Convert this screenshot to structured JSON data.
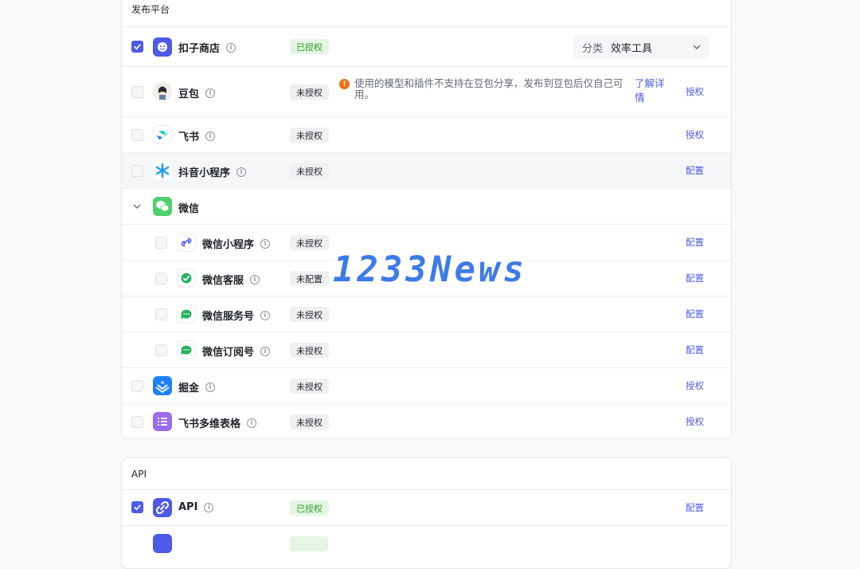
{
  "publish_section": {
    "title": "发布平台",
    "category": {
      "label": "分类",
      "value": "效率工具"
    },
    "warning": {
      "text": "使用的模型和插件不支持在豆包分享，发布到豆包后仅自己可用。",
      "link": "了解详情"
    },
    "rows": [
      {
        "name": "扣子商店",
        "status": "已授权",
        "action": "",
        "checked": true
      },
      {
        "name": "豆包",
        "status": "未授权",
        "action": "授权",
        "checked": false
      },
      {
        "name": "飞书",
        "status": "未授权",
        "action": "授权",
        "checked": false
      },
      {
        "name": "抖音小程序",
        "status": "未授权",
        "action": "配置",
        "checked": false
      },
      {
        "name": "微信",
        "status": "",
        "action": "",
        "checked": false
      },
      {
        "name": "微信小程序",
        "status": "未授权",
        "action": "配置",
        "checked": false
      },
      {
        "name": "微信客服",
        "status": "未配置",
        "action": "配置",
        "checked": false
      },
      {
        "name": "微信服务号",
        "status": "未授权",
        "action": "配置",
        "checked": false
      },
      {
        "name": "微信订阅号",
        "status": "未授权",
        "action": "配置",
        "checked": false
      },
      {
        "name": "掘金",
        "status": "未授权",
        "action": "授权",
        "checked": false
      },
      {
        "name": "飞书多维表格",
        "status": "未授权",
        "action": "授权",
        "checked": false
      }
    ]
  },
  "api_section": {
    "title": "API",
    "rows": [
      {
        "name": "API",
        "status": "已授权",
        "action": "配置",
        "checked": true
      }
    ]
  },
  "watermark": "1233News",
  "colors": {
    "accent": "#4e5ae8",
    "success": "#2ea121",
    "warning": "#f76c0d"
  }
}
